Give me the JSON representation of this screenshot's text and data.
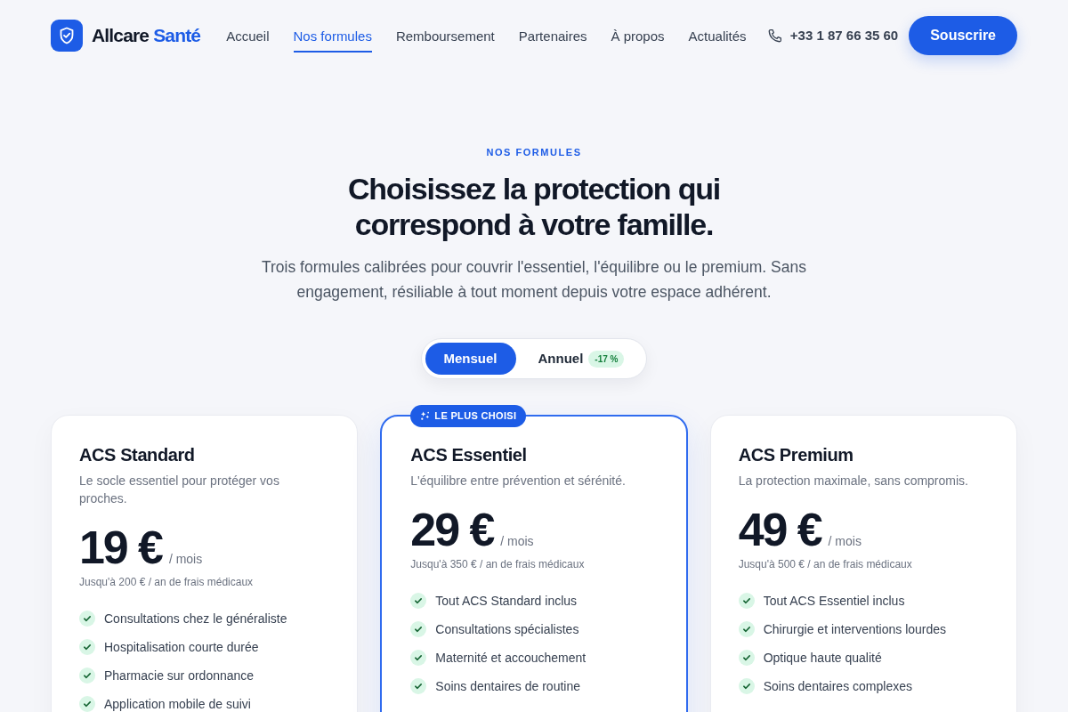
{
  "brand": {
    "name": "Allcare",
    "highlight": "Santé"
  },
  "nav": {
    "links": [
      {
        "label": "Accueil",
        "selected": false
      },
      {
        "label": "Nos formules",
        "selected": true
      },
      {
        "label": "Remboursement",
        "selected": false
      },
      {
        "label": "Partenaires",
        "selected": false
      },
      {
        "label": "À propos",
        "selected": false
      },
      {
        "label": "Actualités",
        "selected": false
      }
    ],
    "phone": "+33 1 87 66 35 60",
    "cta": "Souscrire"
  },
  "hero": {
    "eyebrow": "NOS FORMULES",
    "title": "Choisissez la protection qui correspond à votre famille.",
    "subtitle": "Trois formules calibrées pour couvrir l'essentiel, l'équilibre ou le premium. Sans engagement, résiliable à tout moment depuis votre espace adhérent."
  },
  "billing_toggle": {
    "options": [
      {
        "label": "Mensuel",
        "selected": true
      },
      {
        "label": "Annuel",
        "selected": false,
        "badge": "-17 %"
      }
    ]
  },
  "plans": [
    {
      "name": "ACS Standard",
      "description": "Le socle essentiel pour protéger vos proches.",
      "price": "19 €",
      "period": "/ mois",
      "limit": "Jusqu'à 200 € / an de frais médicaux",
      "featured": false,
      "features": [
        "Consultations chez le généraliste",
        "Hospitalisation courte durée",
        "Pharmacie sur ordonnance",
        "Application mobile de suivi"
      ]
    },
    {
      "name": "ACS Essentiel",
      "description": "L'équilibre entre prévention et sérénité.",
      "price": "29 €",
      "period": "/ mois",
      "limit": "Jusqu'à 350 € / an de frais médicaux",
      "featured": true,
      "ribbon": "LE PLUS CHOISI",
      "features": [
        "Tout ACS Standard inclus",
        "Consultations spécialistes",
        "Maternité et accouchement",
        "Soins dentaires de routine"
      ]
    },
    {
      "name": "ACS Premium",
      "description": "La protection maximale, sans compromis.",
      "price": "49 €",
      "period": "/ mois",
      "limit": "Jusqu'à 500 € / an de frais médicaux",
      "featured": false,
      "features": [
        "Tout ACS Essentiel inclus",
        "Chirurgie et interventions lourdes",
        "Optique haute qualité",
        "Soins dentaires complexes"
      ]
    }
  ]
}
